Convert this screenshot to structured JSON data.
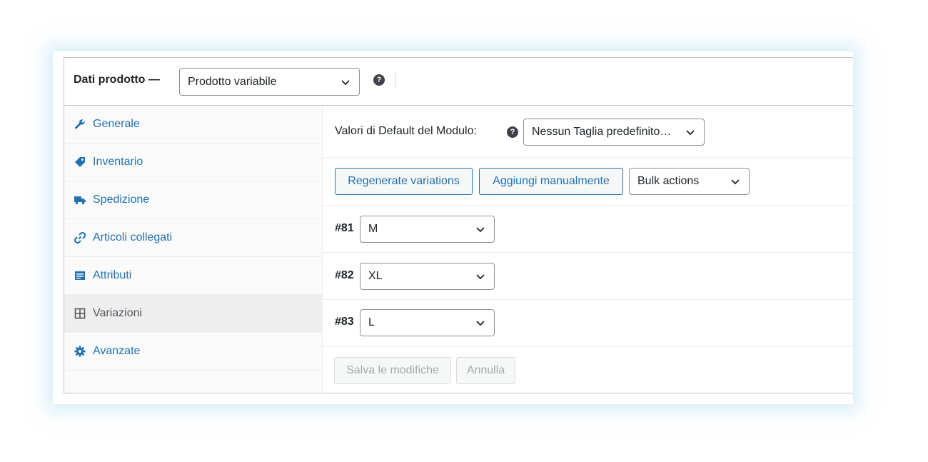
{
  "header": {
    "title": "Dati prodotto —",
    "product_type": "Prodotto variabile"
  },
  "sidebar": {
    "items": [
      {
        "label": "Generale",
        "icon": "wrench-icon"
      },
      {
        "label": "Inventario",
        "icon": "tag-icon"
      },
      {
        "label": "Spedizione",
        "icon": "truck-icon"
      },
      {
        "label": "Articoli collegati",
        "icon": "link-icon"
      },
      {
        "label": "Attributi",
        "icon": "list-card-icon"
      },
      {
        "label": "Variazioni",
        "icon": "grid-icon",
        "active": true
      },
      {
        "label": "Avanzate",
        "icon": "gear-icon"
      }
    ]
  },
  "main": {
    "defaults_label": "Valori di Default del Modulo:",
    "defaults_value": "Nessun Taglia predefinito…",
    "buttons": {
      "regenerate": "Regenerate variations",
      "add_manual": "Aggiungi manualmente",
      "bulk_actions": "Bulk actions"
    },
    "variations": [
      {
        "id": "#81",
        "value": "M"
      },
      {
        "id": "#82",
        "value": "XL"
      },
      {
        "id": "#83",
        "value": "L"
      }
    ],
    "save_label": "Salva le modifiche",
    "cancel_label": "Annulla"
  },
  "colors": {
    "link": "#2271b1",
    "border": "#c3c4c7",
    "text": "#1d2327",
    "disabled": "#a7aaad"
  }
}
